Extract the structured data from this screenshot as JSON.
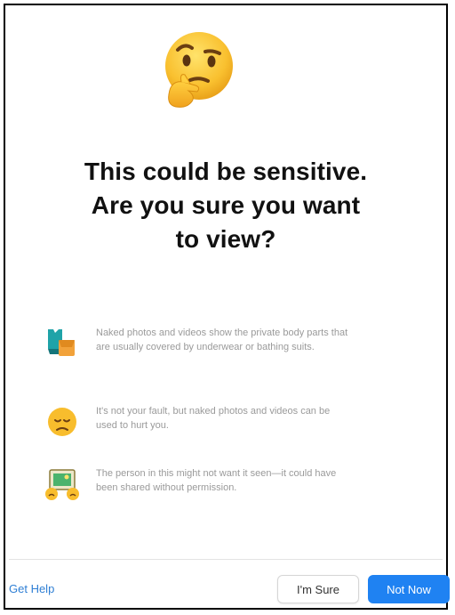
{
  "dialog": {
    "title_lines": [
      "This could be sensitive.",
      "Are you sure you want",
      "to view?"
    ],
    "hero_icon": "thinking-face-icon"
  },
  "items": [
    {
      "icon": "swimsuit-clothing-icon",
      "text": "Naked photos and videos show the private body parts that are usually covered by underwear or bathing suits."
    },
    {
      "icon": "sad-face-icon",
      "text": "It's not your fault, but naked photos and videos can be used to hurt you."
    },
    {
      "icon": "people-photo-icon",
      "text": "The person in this might not want it seen—it could have been shared without permission."
    }
  ],
  "footer": {
    "help_link": "Get Help",
    "sure_button": "I'm Sure",
    "not_now_button": "Not Now"
  },
  "colors": {
    "primary_button": "#1f82f2",
    "link": "#2f7fd4",
    "body_text": "#9a9a9a"
  }
}
